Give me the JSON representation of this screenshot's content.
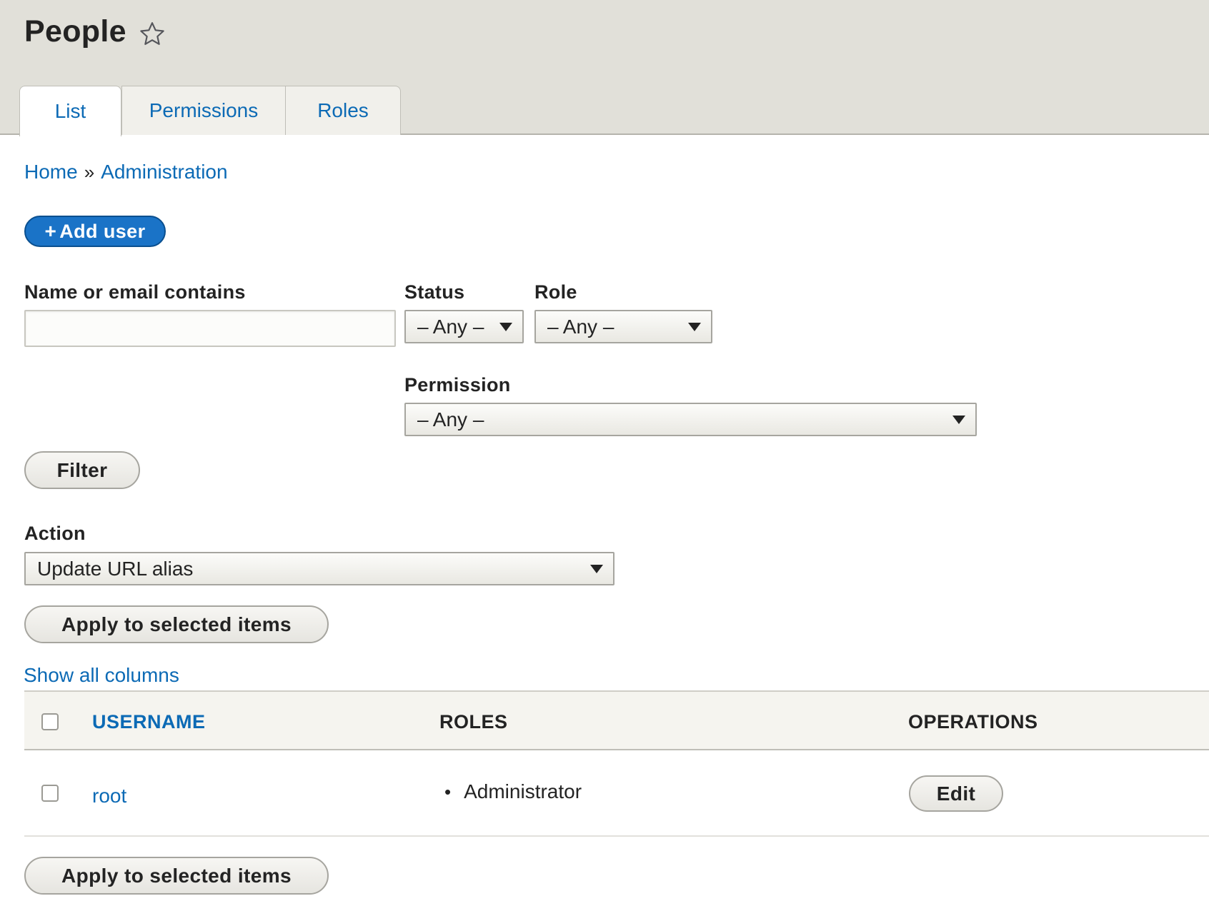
{
  "page": {
    "title": "People"
  },
  "tabs": [
    {
      "label": "List",
      "active": true
    },
    {
      "label": "Permissions",
      "active": false
    },
    {
      "label": "Roles",
      "active": false
    }
  ],
  "breadcrumb": {
    "items": [
      "Home",
      "Administration"
    ],
    "separator": "»"
  },
  "add_user": {
    "label": "Add user",
    "icon": "plus-icon"
  },
  "filters": {
    "name": {
      "label": "Name or email contains",
      "value": "",
      "placeholder": ""
    },
    "status": {
      "label": "Status",
      "value": "– Any –"
    },
    "role": {
      "label": "Role",
      "value": "– Any –"
    },
    "permission": {
      "label": "Permission",
      "value": "– Any –"
    },
    "filter_button": "Filter"
  },
  "action": {
    "label": "Action",
    "value": "Update URL alias",
    "apply_label": "Apply to selected items"
  },
  "show_all_columns": "Show all columns",
  "table": {
    "headers": {
      "username": "USERNAME",
      "roles": "ROLES",
      "operations": "OPERATIONS"
    },
    "rows": [
      {
        "username": "root",
        "roles": [
          "Administrator"
        ],
        "operation": "Edit",
        "selected": false
      }
    ]
  },
  "colors": {
    "header_bg": "#e1e0d9",
    "link": "#0c6ab5",
    "primary_button": "#1a73c7"
  }
}
